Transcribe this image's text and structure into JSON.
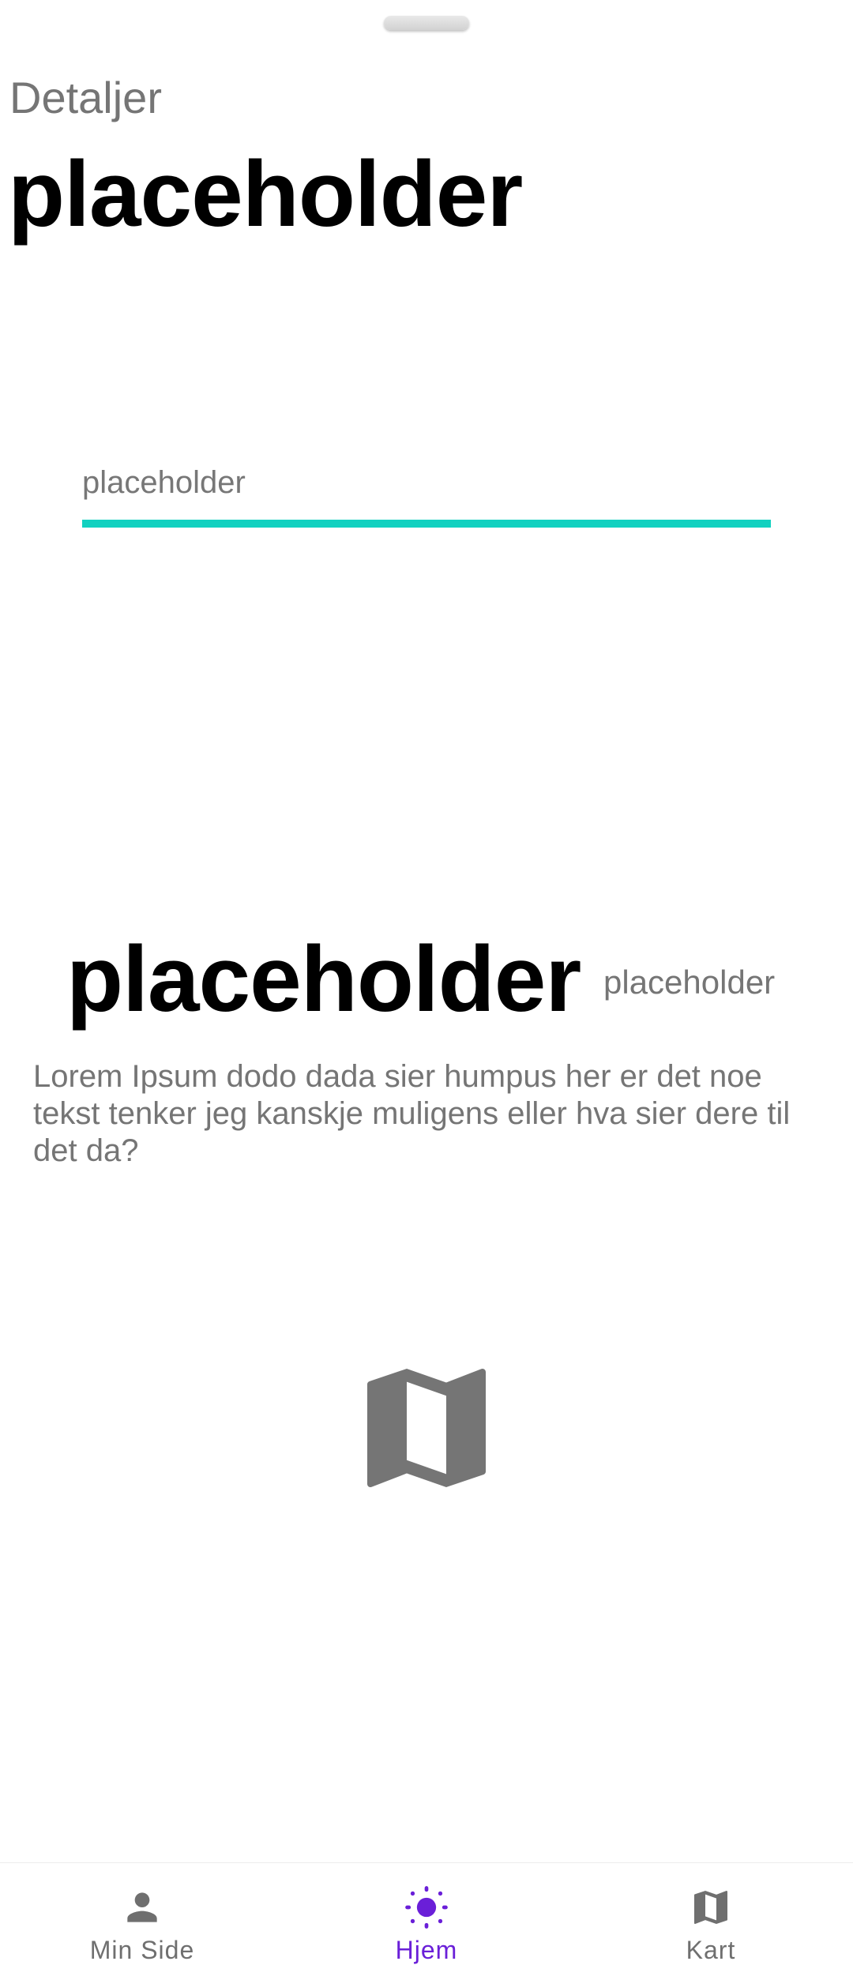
{
  "sheet": {
    "section_label": "Detaljer",
    "title": "placeholder"
  },
  "input": {
    "placeholder": "placeholder",
    "value": "",
    "underline_color": "#12d1c0"
  },
  "details": {
    "big_value": "placeholder",
    "side_value": "placeholder",
    "description": "Lorem Ipsum dodo dada sier humpus her er det noe tekst tenker jeg kanskje muligens eller hva sier dere til det da?",
    "illustration_icon": "map-icon"
  },
  "bottom_nav": {
    "active_color": "#6a1fd8",
    "inactive_color": "#6f6f6f",
    "items": [
      {
        "label": "Min Side",
        "icon": "person-icon",
        "active": false
      },
      {
        "label": "Hjem",
        "icon": "sun-icon",
        "active": true
      },
      {
        "label": "Kart",
        "icon": "map-icon",
        "active": false
      }
    ]
  }
}
